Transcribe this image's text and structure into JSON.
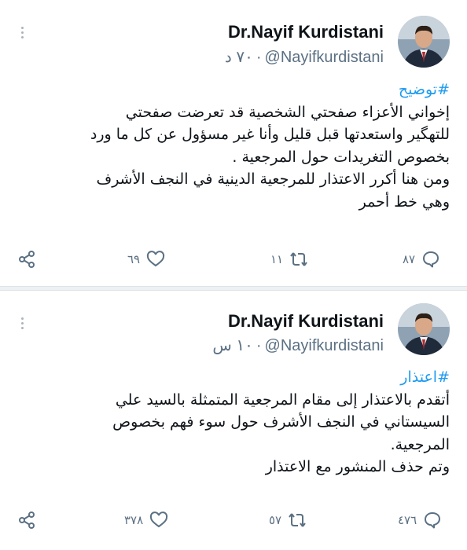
{
  "tweets": [
    {
      "author_name": "Dr.Nayif Kurdistani",
      "handle": "@Nayifkurdistani",
      "time": "٧٠ د",
      "hashtag": "#توضيح",
      "lines": [
        "إخواني الأعزاء صفحتي الشخصية قد تعرضت صفحتي",
        "للتهگير واستعدتها قبل قليل وأنا غير مسؤول عن كل ما ورد",
        "بخصوص التغريدات حول المرجعية .",
        "ومن هنا أكرر الاعتذار للمرجعية الدينية في النجف الأشرف",
        "وهي خط أحمر"
      ],
      "replies": "٨٧",
      "retweets": "١١",
      "likes": "٦٩"
    },
    {
      "author_name": "Dr.Nayif Kurdistani",
      "handle": "@Nayifkurdistani",
      "time": "١٠ س",
      "hashtag": "#اعتذار",
      "lines": [
        "أتقدم بالاعتذار إلى مقام المرجعية المتمثلة بالسيد علي",
        "السيستاني في النجف الأشرف حول سوء فهم بخصوص",
        "المرجعية.",
        "وتم حذف المنشور مع الاعتذار"
      ],
      "replies": "٤٧٦",
      "retweets": "٥٧",
      "likes": "٣٧٨"
    }
  ],
  "icons": {
    "reply": "reply-icon",
    "retweet": "retweet-icon",
    "like": "like-icon",
    "share": "share-icon",
    "more": "more-options-icon"
  },
  "colors": {
    "hashtag": "#1d9bf0",
    "secondary": "#5b7083",
    "text": "#0f1419"
  }
}
